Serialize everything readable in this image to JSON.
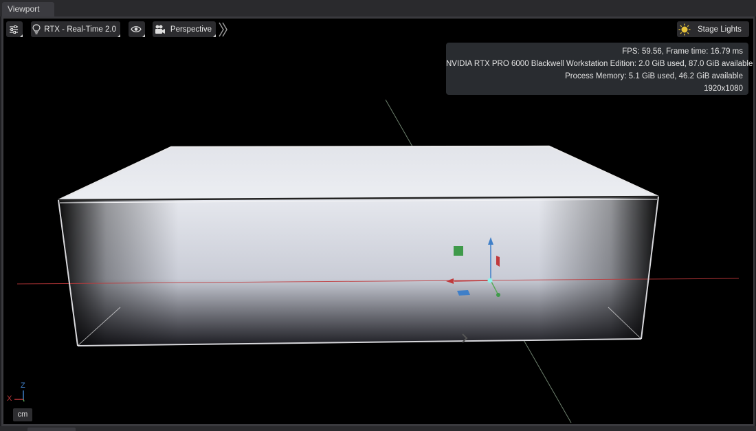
{
  "tab": {
    "title": "Viewport"
  },
  "toolbar": {
    "settings_icon": "sliders-icon",
    "renderer_label": "RTX - Real-Time 2.0",
    "renderer_icon": "lightbulb-icon",
    "visibility_icon": "eye-icon",
    "camera_label": "Perspective",
    "camera_icon": "camera-icon",
    "expand_icon": "double-chevron-right-icon",
    "lights_label": "Stage Lights",
    "lights_icon": "sun-icon"
  },
  "stats": {
    "fps_line": "FPS: 59.56, Frame time: 16.79 ms",
    "gpu_line": "NVIDIA RTX PRO 6000 Blackwell Workstation Edition: 2.0 GiB used, 87.0 GiB available",
    "memory_line": "Process Memory: 5.1 GiB used, 46.2 GiB available",
    "resolution_line": "1920x1080"
  },
  "axes": {
    "z_label": "Z",
    "x_label": "X",
    "unit": "cm"
  },
  "colors": {
    "x_axis": "#c0393b",
    "y_axis": "#5aa85a",
    "z_axis": "#3f7fc8",
    "accent_yellow": "#e7c33a"
  }
}
